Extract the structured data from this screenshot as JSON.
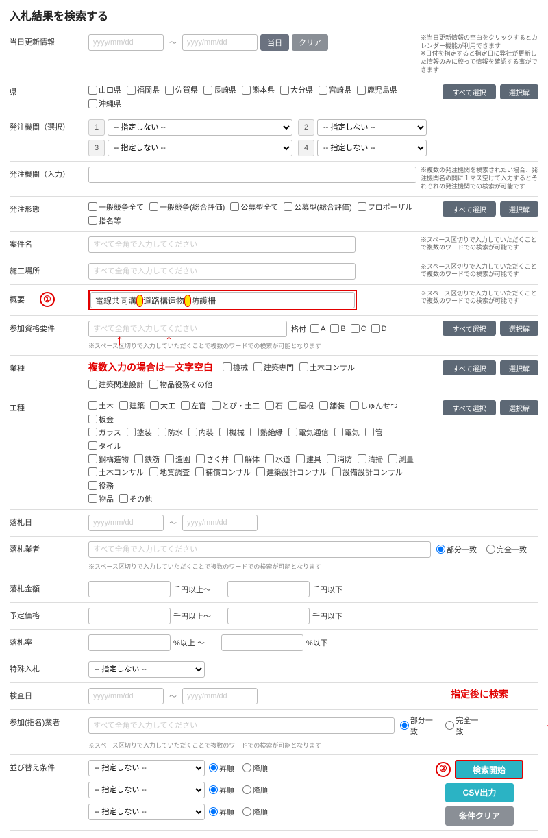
{
  "page_title": "入札結果を検索する",
  "labels": {
    "update_info": "当日更新情報",
    "prefecture": "県",
    "org_select": "発注機関（選択）",
    "org_input": "発注機関（入力）",
    "bid_type": "発注形態",
    "case_name": "案件名",
    "work_place": "施工場所",
    "summary": "概要",
    "qualification": "参加資格要件",
    "industry": "業種",
    "work_type": "工種",
    "award_date": "落札日",
    "award_company": "落札業者",
    "award_amount": "落札金額",
    "planned_price": "予定価格",
    "award_rate": "落札率",
    "special_bid": "特殊入札",
    "inspection_date": "検査日",
    "designated_company": "参加(指名)業者",
    "sort": "並び替え条件"
  },
  "placeholders": {
    "date": "yyyy/mm/dd",
    "zenkaku": "すべて全角で入力してください"
  },
  "buttons": {
    "today": "当日",
    "clear": "クリア",
    "select_all": "すべて選択する",
    "deselect": "選択解除",
    "search": "検索開始",
    "csv": "CSV出力",
    "cond_clear": "条件クリア"
  },
  "hints": {
    "date_hint": "※当日更新情報の空白をクリックするとカレンダー機能が利用できます\n※日付を指定すると指定日に弊社が更新した情報のみに絞って情報を確認する事ができます",
    "org_input_hint": "※複数の発注機関を検索されたい場合、発注機関名の間に１マス空けて入力するとそれぞれの発注機関での検索が可能です",
    "space_hint": "※スペース区切りで入力していただくことで複数のワードでの検索が可能です",
    "space_note": "※スペース区切りで入力していただくことで複数のワードでの検索が可能となります"
  },
  "prefectures": [
    "山口県",
    "福岡県",
    "佐賀県",
    "長崎県",
    "熊本県",
    "大分県",
    "宮崎県",
    "鹿児島県",
    "沖縄県"
  ],
  "select_none": "-- 指定しない --",
  "bid_types": [
    "一般競争全て",
    "一般競争(総合評価)",
    "公募型全て",
    "公募型(総合評価)",
    "プロポーザル",
    "指名等"
  ],
  "summary_value": "電線共同溝　道路構造物　防護柵",
  "grade_label": "格付",
  "grades": [
    "A",
    "B",
    "C",
    "D"
  ],
  "industries_row1_suffix": [
    "機械",
    "建築専門",
    "土木コンサル"
  ],
  "industries_row2": [
    "建築関連設計",
    "物品役務その他"
  ],
  "work_types_r1": [
    "土木",
    "建築",
    "大工",
    "左官",
    "とび・土工",
    "石",
    "屋根",
    "舗装",
    "しゅんせつ",
    "板金"
  ],
  "work_types_r2": [
    "ガラス",
    "塗装",
    "防水",
    "内装",
    "機械",
    "熱絶縁",
    "電気通信",
    "電気",
    "管",
    "タイル"
  ],
  "work_types_r3": [
    "鋼構造物",
    "鉄筋",
    "造園",
    "さく井",
    "解体",
    "水道",
    "建具",
    "消防",
    "清掃",
    "測量"
  ],
  "work_types_r4": [
    "土木コンサル",
    "地質調査",
    "補償コンサル",
    "建築設計コンサル",
    "設備設計コンサル",
    "役務"
  ],
  "work_types_r5": [
    "物品",
    "その他"
  ],
  "units": {
    "sen_ijo": "千円以上～",
    "sen_ika": "千円以下",
    "pct_ijo": "%以上 ～",
    "pct_ika": "%以下"
  },
  "radio": {
    "partial": "部分一致",
    "exact": "完全一致",
    "asc": "昇順",
    "desc": "降順"
  },
  "annotations": {
    "one": "①",
    "two": "②",
    "multi_input": "複数入力の場合は一文字空白",
    "after_set": "指定後に検索"
  }
}
